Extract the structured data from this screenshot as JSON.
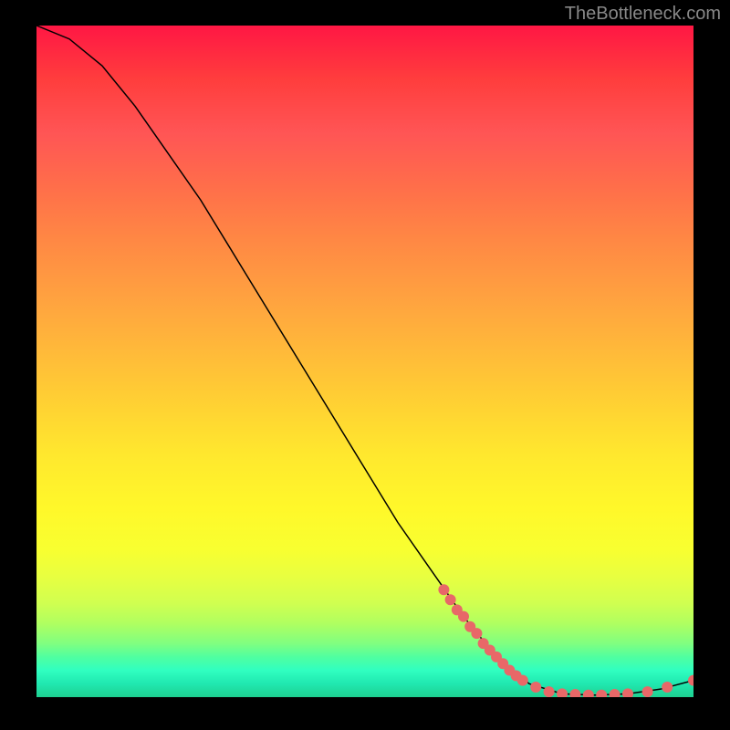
{
  "attribution": "TheBottleneck.com",
  "chart_data": {
    "type": "line",
    "title": "",
    "xlabel": "",
    "ylabel": "",
    "xlim": [
      0,
      100
    ],
    "ylim": [
      0,
      100
    ],
    "curve": [
      {
        "x": 0,
        "y": 100
      },
      {
        "x": 5,
        "y": 98
      },
      {
        "x": 10,
        "y": 94
      },
      {
        "x": 15,
        "y": 88
      },
      {
        "x": 20,
        "y": 81
      },
      {
        "x": 25,
        "y": 74
      },
      {
        "x": 30,
        "y": 66
      },
      {
        "x": 35,
        "y": 58
      },
      {
        "x": 40,
        "y": 50
      },
      {
        "x": 45,
        "y": 42
      },
      {
        "x": 50,
        "y": 34
      },
      {
        "x": 55,
        "y": 26
      },
      {
        "x": 60,
        "y": 19
      },
      {
        "x": 65,
        "y": 12
      },
      {
        "x": 70,
        "y": 6
      },
      {
        "x": 75,
        "y": 2
      },
      {
        "x": 80,
        "y": 0.5
      },
      {
        "x": 85,
        "y": 0.3
      },
      {
        "x": 90,
        "y": 0.5
      },
      {
        "x": 95,
        "y": 1.2
      },
      {
        "x": 100,
        "y": 2.5
      }
    ],
    "markers": [
      {
        "x": 62,
        "y": 16
      },
      {
        "x": 63,
        "y": 14.5
      },
      {
        "x": 64,
        "y": 13
      },
      {
        "x": 65,
        "y": 12
      },
      {
        "x": 66,
        "y": 10.5
      },
      {
        "x": 67,
        "y": 9.5
      },
      {
        "x": 68,
        "y": 8
      },
      {
        "x": 69,
        "y": 7
      },
      {
        "x": 70,
        "y": 6
      },
      {
        "x": 71,
        "y": 5
      },
      {
        "x": 72,
        "y": 4
      },
      {
        "x": 73,
        "y": 3.2
      },
      {
        "x": 74,
        "y": 2.5
      },
      {
        "x": 76,
        "y": 1.5
      },
      {
        "x": 78,
        "y": 0.8
      },
      {
        "x": 80,
        "y": 0.5
      },
      {
        "x": 82,
        "y": 0.4
      },
      {
        "x": 84,
        "y": 0.3
      },
      {
        "x": 86,
        "y": 0.3
      },
      {
        "x": 88,
        "y": 0.4
      },
      {
        "x": 90,
        "y": 0.5
      },
      {
        "x": 93,
        "y": 0.8
      },
      {
        "x": 96,
        "y": 1.5
      },
      {
        "x": 100,
        "y": 2.5
      }
    ],
    "marker_color": "#e86868",
    "curve_color": "#000000"
  }
}
